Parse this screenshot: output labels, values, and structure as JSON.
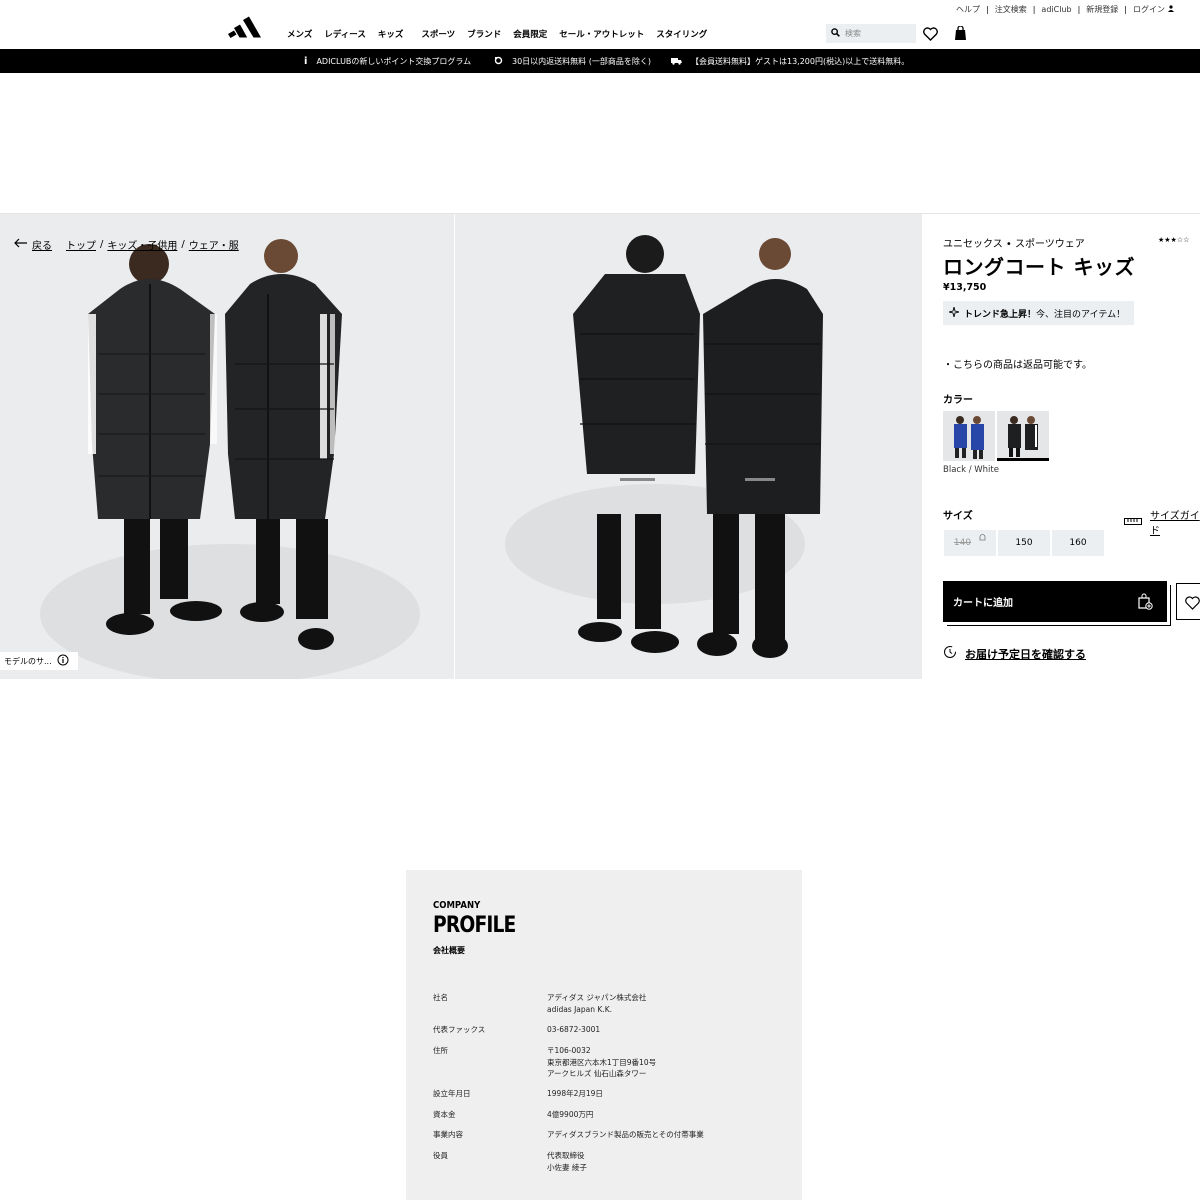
{
  "header": {
    "utility_links": [
      "ヘルプ",
      "注文検索",
      "adiClub",
      "新規登録",
      "ログイン"
    ],
    "nav": [
      "メンズ",
      "レディース",
      "キッズ",
      "スポーツ",
      "ブランド",
      "会員限定",
      "セール・アウトレット",
      "スタイリング"
    ],
    "search_placeholder": "検索"
  },
  "banner": {
    "items": [
      "ADICLUBの新しいポイント交換プログラム",
      "30日以内返送料無料 (一部商品を除く)",
      "【会員送料無料】ゲストは13,200円(税込)以上で送料無料。"
    ]
  },
  "breadcrumb": {
    "back": "戻る",
    "items": [
      "トップ",
      "キッズ・子供用",
      "ウェア・服"
    ]
  },
  "gallery": {
    "model_info": "モデルのサ..."
  },
  "product": {
    "category": "ユニセックス • スポーツウェア",
    "rating": "★★★☆☆",
    "title": "ロングコート キッズ",
    "price": "¥13,750",
    "trend_bold": "トレンド急上昇！",
    "trend_text": "今、注目のアイテム！",
    "return_note": "・こちらの商品は返品可能です。",
    "color_label": "カラー",
    "color_selected": "Black / White",
    "size_label": "サイズ",
    "size_guide": "サイズガイド",
    "sizes": [
      "140",
      "150",
      "160"
    ],
    "add_to_cart": "カートに追加",
    "delivery": "お届け予定日を確認する"
  },
  "profile": {
    "company": "COMPANY",
    "heading": "PROFILE",
    "sub": "会社概要",
    "rows": [
      {
        "k": "社名",
        "v1": "アディダス ジャパン株式会社",
        "v2": "adidas Japan K.K.",
        "v3": ""
      },
      {
        "k": "代表ファックス",
        "v1": "03-6872-3001",
        "v2": "",
        "v3": ""
      },
      {
        "k": "住所",
        "v1": "〒106-0032",
        "v2": "東京都港区六本木1丁目9番10号",
        "v3": "アークヒルズ 仙石山森タワー"
      },
      {
        "k": "設立年月日",
        "v1": "1998年2月19日",
        "v2": "",
        "v3": ""
      },
      {
        "k": "資本金",
        "v1": "4億9900万円",
        "v2": "",
        "v3": ""
      },
      {
        "k": "事業内容",
        "v1": "アディダスブランド製品の販売とその付帯事業",
        "v2": "",
        "v3": ""
      },
      {
        "k": "役員",
        "v1": "代表取締役",
        "v2": "小佐妻 綾子",
        "v3": ""
      }
    ]
  }
}
